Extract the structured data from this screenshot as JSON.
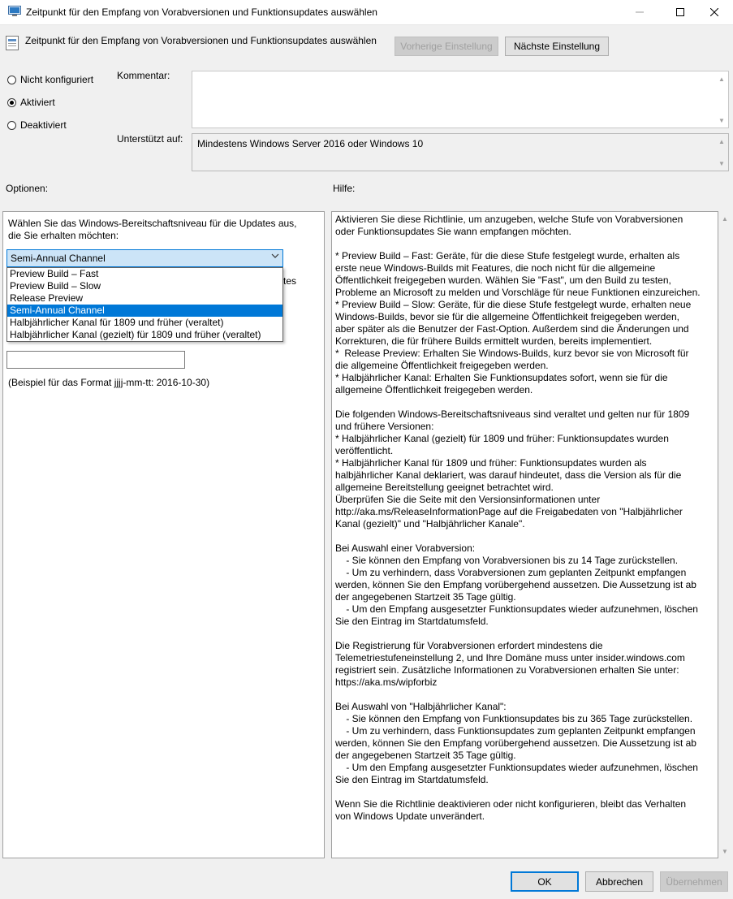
{
  "window": {
    "title": "Zeitpunkt für den Empfang von Vorabversionen und Funktionsupdates auswählen"
  },
  "header": {
    "title": "Zeitpunkt für den Empfang von Vorabversionen und Funktionsupdates auswählen",
    "prev_button": "Vorherige Einstellung",
    "next_button": "Nächste Einstellung"
  },
  "state": {
    "options": [
      {
        "label": "Nicht konfiguriert",
        "selected": false
      },
      {
        "label": "Aktiviert",
        "selected": true
      },
      {
        "label": "Deaktiviert",
        "selected": false
      }
    ]
  },
  "comment": {
    "label": "Kommentar:",
    "value": ""
  },
  "supported": {
    "label": "Unterstützt auf:",
    "value": "Mindestens Windows Server 2016 oder Windows 10"
  },
  "options_section": {
    "label": "Optionen:",
    "intro": "Wählen Sie das Windows-Bereitschaftsniveau für die Updates aus, die Sie erhalten möchten:",
    "dropdown_value": "Semi-Annual Channel",
    "dropdown_items": [
      "Preview Build – Fast",
      "Preview Build – Slow",
      "Release Preview",
      "Semi-Annual Channel",
      "Halbjährlicher Kanal für 1809 und früher (veraltet)",
      "Halbjährlicher Kanal (gezielt) für 1809 und früher (veraltet)"
    ],
    "selected_index": 3,
    "partial_text_1": "tes",
    "date_input_value": "",
    "date_hint": "(Beispiel für das Format jjjj-mm-tt: 2016-10-30)"
  },
  "help_section": {
    "label": "Hilfe:",
    "text": "Aktivieren Sie diese Richtlinie, um anzugeben, welche Stufe von Vorabversionen oder Funktionsupdates Sie wann empfangen möchten.\n\n* Preview Build – Fast: Geräte, für die diese Stufe festgelegt wurde, erhalten als erste neue Windows-Builds mit Features, die noch nicht für die allgemeine Öffentlichkeit freigegeben wurden. Wählen Sie \"Fast\", um den Build zu testen, Probleme an Microsoft zu melden und Vorschläge für neue Funktionen einzureichen.\n* Preview Build – Slow: Geräte, für die diese Stufe festgelegt wurde, erhalten neue Windows-Builds, bevor sie für die allgemeine Öffentlichkeit freigegeben werden, aber später als die Benutzer der Fast-Option. Außerdem sind die Änderungen und Korrekturen, die für frühere Builds ermittelt wurden, bereits implementiert.\n*  Release Preview: Erhalten Sie Windows-Builds, kurz bevor sie von Microsoft für die allgemeine Öffentlichkeit freigegeben werden.\n* Halbjährlicher Kanal: Erhalten Sie Funktionsupdates sofort, wenn sie für die allgemeine Öffentlichkeit freigegeben werden.\n\nDie folgenden Windows-Bereitschaftsniveaus sind veraltet und gelten nur für 1809 und frühere Versionen:\n* Halbjährlicher Kanal (gezielt) für 1809 und früher: Funktionsupdates wurden veröffentlicht.\n* Halbjährlicher Kanal für 1809 und früher: Funktionsupdates wurden als halbjährlicher Kanal deklariert, was darauf hindeutet, dass die Version als für die allgemeine Bereitstellung geeignet betrachtet wird.\nÜberprüfen Sie die Seite mit den Versionsinformationen unter http://aka.ms/ReleaseInformationPage auf die Freigabedaten von \"Halbjährlicher Kanal (gezielt)\" und \"Halbjährlicher Kanale\".\n\nBei Auswahl einer Vorabversion:\n    - Sie können den Empfang von Vorabversionen bis zu 14 Tage zurückstellen.\n    - Um zu verhindern, dass Vorabversionen zum geplanten Zeitpunkt empfangen werden, können Sie den Empfang vorübergehend aussetzen. Die Aussetzung ist ab der angegebenen Startzeit 35 Tage gültig.\n    - Um den Empfang ausgesetzter Funktionsupdates wieder aufzunehmen, löschen Sie den Eintrag im Startdatumsfeld.\n\nDie Registrierung für Vorabversionen erfordert mindestens die Telemetriestufeneinstellung 2, und Ihre Domäne muss unter insider.windows.com registriert sein. Zusätzliche Informationen zu Vorabversionen erhalten Sie unter: https://aka.ms/wipforbiz\n\nBei Auswahl von \"Halbjährlicher Kanal\":\n    - Sie können den Empfang von Funktionsupdates bis zu 365 Tage zurückstellen.\n    - Um zu verhindern, dass Funktionsupdates zum geplanten Zeitpunkt empfangen werden, können Sie den Empfang vorübergehend aussetzen. Die Aussetzung ist ab der angegebenen Startzeit 35 Tage gültig.\n    - Um den Empfang ausgesetzter Funktionsupdates wieder aufzunehmen, löschen Sie den Eintrag im Startdatumsfeld.\n\nWenn Sie die Richtlinie deaktivieren oder nicht konfigurieren, bleibt das Verhalten von Windows Update unverändert."
  },
  "footer": {
    "ok": "OK",
    "cancel": "Abbrechen",
    "apply": "Übernehmen"
  }
}
